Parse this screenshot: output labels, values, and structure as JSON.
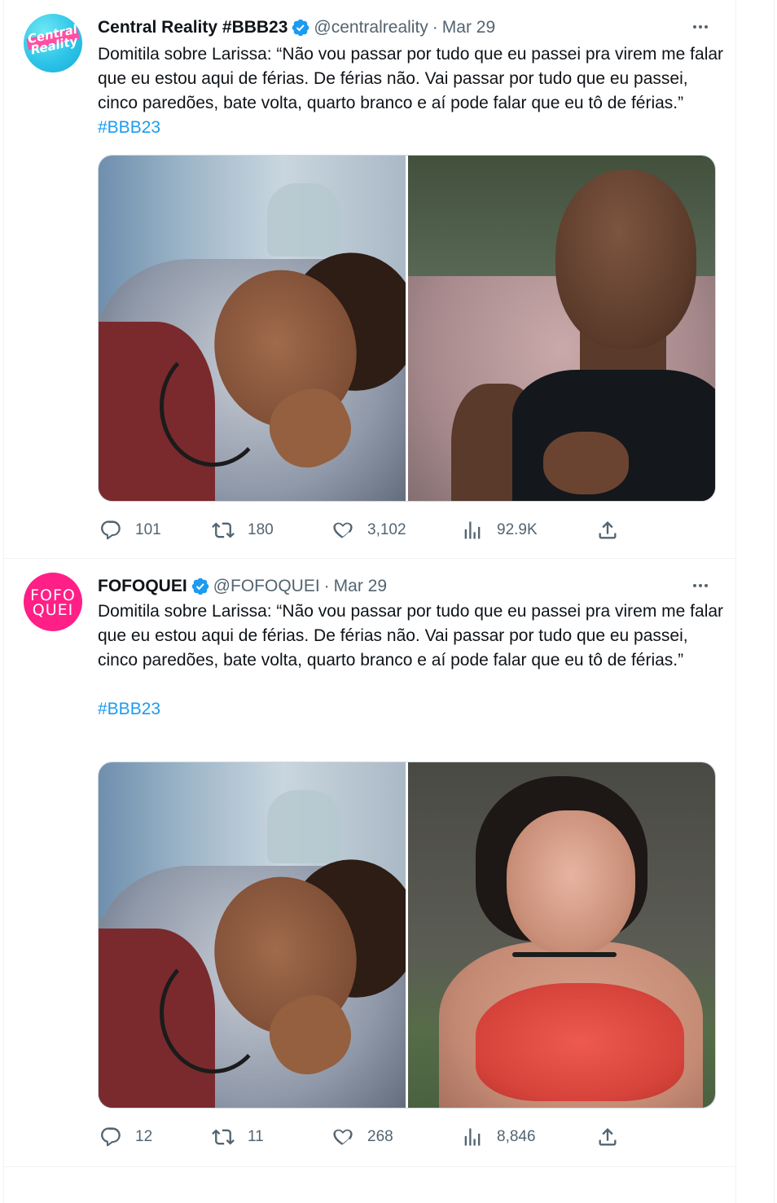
{
  "tweets": [
    {
      "avatar_text": "Central Reality",
      "author_name": "Central Reality #BBB23",
      "verified_icon": "verified-badge-icon",
      "handle": "@centralreality",
      "separator": "·",
      "date": "Mar 29",
      "text_main": "Domitila sobre Larissa: “Não vou passar por tudo que eu passei pra virem me falar que eu estou aqui de férias. De férias não. Vai passar por tudo que eu passei, cinco paredões, bate volta, quarto branco e aí pode falar que eu tô de férias.” ",
      "hashtag": "#BBB23",
      "images": [
        "woman-lying-on-pillow",
        "bald-man-black-tank-top"
      ],
      "stats": {
        "replies": "101",
        "retweets": "180",
        "likes": "3,102",
        "views": "92.9K"
      }
    },
    {
      "avatar_text": "FOFOQUEI",
      "author_name": "FOFOQUEI",
      "verified_icon": "verified-badge-icon",
      "handle": "@FOFOQUEI",
      "separator": "·",
      "date": "Mar 29",
      "text_main": "Domitila sobre Larissa: “Não vou passar por tudo que eu passei pra virem me falar que eu estou aqui de férias. De férias não. Vai passar por tudo que eu passei, cinco paredões, bate volta, quarto branco e aí pode falar que eu tô de férias.”",
      "hashtag": "#BBB23",
      "images": [
        "woman-lying-on-pillow",
        "woman-red-bikini"
      ],
      "stats": {
        "replies": "12",
        "retweets": "11",
        "likes": "268",
        "views": "8,846"
      }
    }
  ],
  "colors": {
    "text": "#0f1419",
    "secondary": "#536471",
    "link": "#1d9bf0",
    "verified": "#1d9bf0",
    "divider": "#eff3f4",
    "central_avatar": "#2ec5e8",
    "fofoquei_avatar": "#ff1f86"
  }
}
